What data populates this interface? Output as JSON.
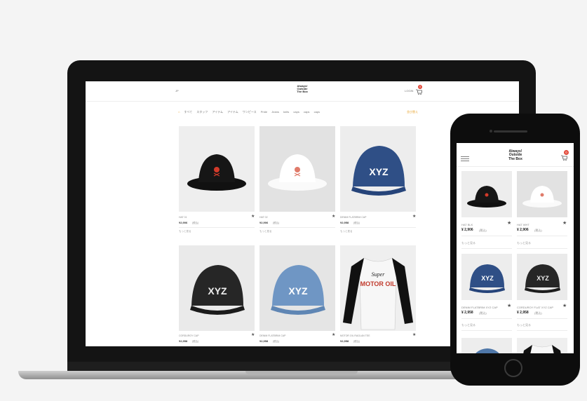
{
  "brand": {
    "line1": "Always!",
    "line2": "Outside",
    "line3": "The Box"
  },
  "laptop_header": {
    "left_text": "JP",
    "login_label": "LOGIN",
    "cart_count": "0"
  },
  "breadcrumbs": [
    "すべて",
    "スタッフ",
    "アイテム",
    "アイテム",
    "ワンピース",
    "Pride",
    "Jeans",
    "knits",
    "caps",
    "caps",
    "caps"
  ],
  "sort_label": "並び替え",
  "laptop_products": [
    {
      "name": "HAT 01",
      "price": "¥2,906",
      "price_note": "(税込)",
      "note": "もっと見る"
    },
    {
      "name": "HAT 02",
      "price": "¥2,906",
      "price_note": "(税込)",
      "note": "もっと見る"
    },
    {
      "name": "DENIM FLATBRIM CAP",
      "price": "¥2,958",
      "price_note": "(税込)",
      "note": "もっと見る"
    },
    {
      "name": "CORDUROY CAP",
      "price": "¥2,958",
      "price_note": "(税込)",
      "note": ""
    },
    {
      "name": "DENIM FLATBRIM CAP",
      "price": "¥2,958",
      "price_note": "(税込)",
      "note": ""
    },
    {
      "name": "MOTOR OIL RAGLAN TEE",
      "price": "¥2,958",
      "price_note": "(税込)",
      "note": ""
    }
  ],
  "phone_header": {
    "menu_icon": "hamburger-icon",
    "cart_count": "0"
  },
  "phone_products": [
    {
      "name": "HAT BLK",
      "price": "¥ 2,906",
      "price_note": "(税込)",
      "note": "もっと見る"
    },
    {
      "name": "HAT WHT",
      "price": "¥ 2,906",
      "price_note": "(税込)",
      "note": "もっと見る"
    },
    {
      "name": "DENIM FLATBRIM XYZ CAP",
      "price": "¥ 2,958",
      "price_note": "(税込)",
      "note": "もっと見る"
    },
    {
      "name": "CORDUROY FLAT XYZ CAP",
      "price": "¥ 2,958",
      "price_note": "(税込)",
      "note": "もっと見る"
    }
  ],
  "product_graphics": {
    "cap_text": "XYZ",
    "tee_line1": "Super",
    "tee_line2": "MOTOR OIL"
  },
  "colors": {
    "accent": "#e8a735",
    "badge": "#e24a3b",
    "dark": "#141414"
  }
}
